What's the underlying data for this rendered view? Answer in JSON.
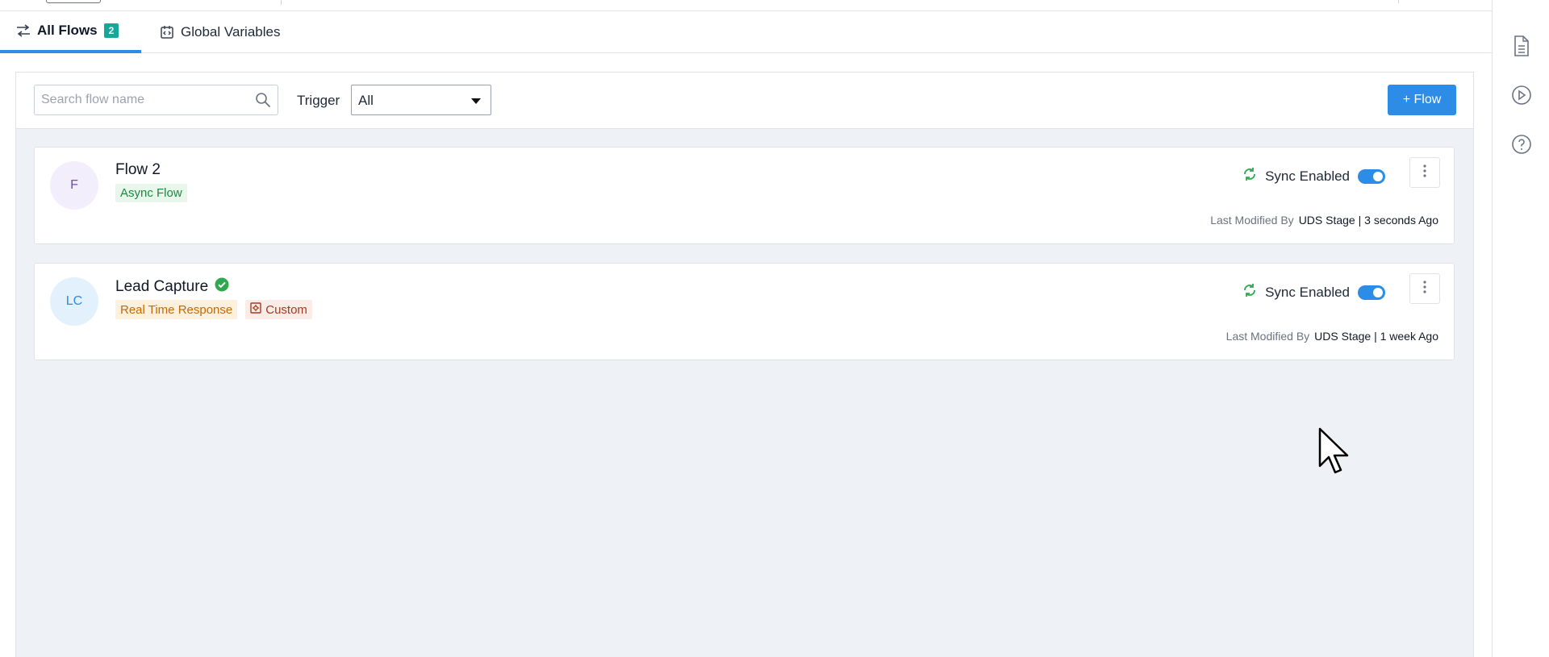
{
  "tabs": {
    "all_flows": {
      "label": "All Flows",
      "count": "2"
    },
    "global_variables": {
      "label": "Global Variables"
    }
  },
  "toolbar": {
    "search_placeholder": "Search flow name",
    "trigger_label": "Trigger",
    "trigger_value": "All",
    "add_flow_label": "+ Flow"
  },
  "flows": [
    {
      "avatar": "F",
      "name": "Flow 2",
      "verified": false,
      "tags": [
        "Async Flow"
      ],
      "sync_label": "Sync Enabled",
      "sync_enabled": true,
      "modified_label": "Last Modified By",
      "modified_value": "UDS Stage | 3 seconds Ago"
    },
    {
      "avatar": "LC",
      "name": "Lead Capture",
      "verified": true,
      "tags": [
        "Real Time Response",
        "Custom"
      ],
      "sync_label": "Sync Enabled",
      "sync_enabled": true,
      "modified_label": "Last Modified By",
      "modified_value": "UDS Stage | 1 week Ago"
    }
  ],
  "rail_icons": [
    "document-icon",
    "play-circle-icon",
    "help-circle-icon"
  ],
  "colors": {
    "accent": "#2d8de6",
    "badge": "#17a79a",
    "success": "#2fa84f"
  }
}
